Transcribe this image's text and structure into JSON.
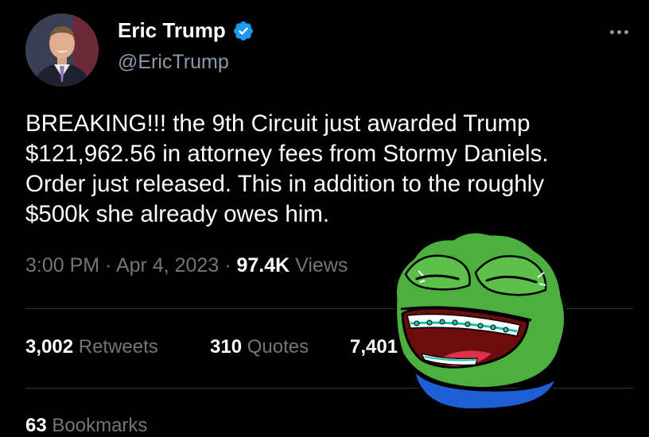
{
  "author": {
    "display_name": "Eric Trump",
    "handle": "@EricTrump",
    "verified": true,
    "avatar": "profile-photo"
  },
  "tweet": {
    "text": "BREAKING!!! the 9th Circuit just awarded Trump\n$121,962.56 in attorney fees from Stormy Daniels.\nOrder just released. This in addition to the roughly\n$500k she already owes him.",
    "time": "3:00 PM",
    "date": "Apr 4, 2023",
    "separator": "·",
    "views_count": "97.4K",
    "views_label": "Views"
  },
  "stats": {
    "retweets_count": "3,002",
    "retweets_label": "Retweets",
    "quotes_count": "310",
    "quotes_label": "Quotes",
    "likes_count": "7,401",
    "bookmarks_count": "63",
    "bookmarks_label": "Bookmarks"
  },
  "icons": {
    "verified": "verified-badge-icon",
    "more": "more-options-icon",
    "sticker": "laughing-frog-sticker"
  },
  "colors": {
    "background": "#000000",
    "text": "#ffffff",
    "secondary": "#71767b",
    "verified": "#1d9bf0",
    "divider": "#2f3336",
    "sticker_green": "#4caf3f",
    "sticker_blue": "#1f5fd6"
  }
}
